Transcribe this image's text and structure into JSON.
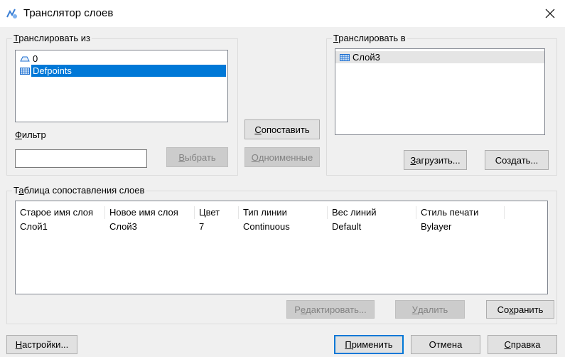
{
  "window": {
    "title": "Транслятор слоев"
  },
  "from_group": {
    "label_acc": "Т",
    "label_rest": "ранслировать из",
    "items": [
      {
        "name": "0",
        "selected": false
      },
      {
        "name": "Defpoints",
        "selected": true
      }
    ],
    "filter_acc": "Ф",
    "filter_rest": "ильтр",
    "filter_value": "",
    "select_acc": "В",
    "select_rest": "ыбрать"
  },
  "middle": {
    "map_acc": "С",
    "map_rest": "опоставить",
    "same_acc": "О",
    "same_rest": "дноименные"
  },
  "to_group": {
    "label_pre": "",
    "label_acc": "Т",
    "label_rest": "ранслировать в",
    "items": [
      {
        "name": "Слой3",
        "selected": false
      }
    ],
    "load_acc": "З",
    "load_rest": "агрузить...",
    "create_pre": "Соз",
    "create_acc": "д",
    "create_rest": "ать..."
  },
  "mapping": {
    "label_pre": "Т",
    "label_acc": "а",
    "label_rest": "блица сопоставления слоев",
    "columns": [
      "Старое имя слоя",
      "Новое имя слоя",
      "Цвет",
      "Тип линии",
      "Вес линий",
      "Стиль печати"
    ],
    "rows": [
      [
        "Слой1",
        "Слой3",
        "7",
        "Continuous",
        "Default",
        "Bylayer"
      ]
    ],
    "edit_pre": "Р",
    "edit_acc": "е",
    "edit_rest": "дактировать...",
    "delete_pre": "",
    "delete_acc": "У",
    "delete_rest": "далить",
    "save_pre": "Со",
    "save_acc": "х",
    "save_rest": "ранить"
  },
  "footer": {
    "settings_acc": "Н",
    "settings_rest": "астройки...",
    "apply_acc": "П",
    "apply_rest": "рименить",
    "cancel_label": "Отмена",
    "help_acc": "С",
    "help_rest": "правка"
  },
  "colors": {
    "accent": "#0078d7",
    "disabled_text": "#838383"
  }
}
